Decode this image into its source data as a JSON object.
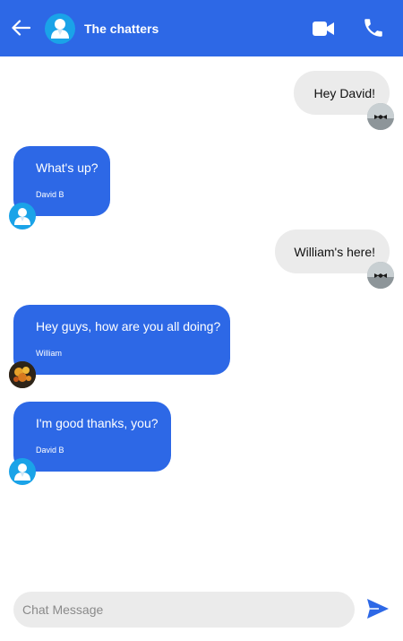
{
  "header": {
    "title": "The chatters",
    "back_icon": "arrow-left-icon",
    "avatar_icon": "user-icon",
    "video_icon": "video-camera-icon",
    "call_icon": "phone-icon",
    "background_color": "#2d68e6"
  },
  "messages": [
    {
      "direction": "outgoing",
      "text": "Hey David!"
    },
    {
      "direction": "incoming",
      "text": "What's up?",
      "sender": "David B"
    },
    {
      "direction": "outgoing",
      "text": "William's here!"
    },
    {
      "direction": "incoming",
      "text": "Hey guys, how are you all doing?",
      "sender": "William"
    },
    {
      "direction": "incoming",
      "text": "I'm good thanks, you?",
      "sender": "David B"
    }
  ],
  "composer": {
    "placeholder": "Chat Message",
    "value": "",
    "send_icon": "send-icon"
  },
  "colors": {
    "accent": "#2d68e6",
    "outgoing_bubble": "#ebebeb",
    "avatar_default": "#1aa3e8"
  }
}
